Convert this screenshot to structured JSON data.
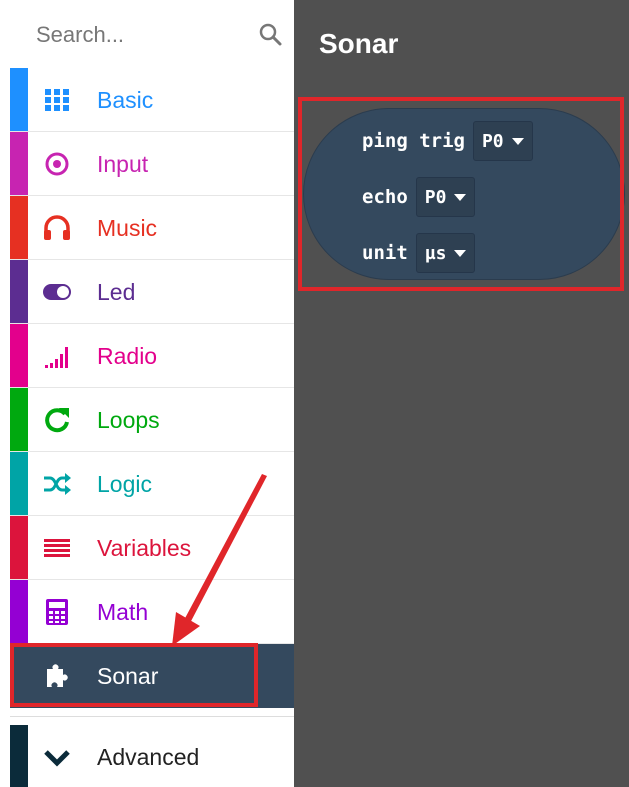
{
  "search": {
    "placeholder": "Search..."
  },
  "sidebar": {
    "items": [
      {
        "label": "Basic",
        "icon": "grid-icon",
        "color": "#1e90ff"
      },
      {
        "label": "Input",
        "icon": "target-icon",
        "color": "#c724b1"
      },
      {
        "label": "Music",
        "icon": "headphones-icon",
        "color": "#e63022"
      },
      {
        "label": "Led",
        "icon": "toggle-icon",
        "color": "#5c2d91"
      },
      {
        "label": "Radio",
        "icon": "signal-bars-icon",
        "color": "#e3008c"
      },
      {
        "label": "Loops",
        "icon": "refresh-icon",
        "color": "#00a90f"
      },
      {
        "label": "Logic",
        "icon": "shuffle-icon",
        "color": "#00a4a6"
      },
      {
        "label": "Variables",
        "icon": "lines-icon",
        "color": "#dc143c"
      },
      {
        "label": "Math",
        "icon": "calculator-icon",
        "color": "#9400d3"
      },
      {
        "label": "Sonar",
        "icon": "puzzle-icon",
        "color": "#34495e"
      }
    ],
    "advanced": {
      "label": "Advanced",
      "icon": "chevron-down-icon",
      "color": "#0b2b3a"
    }
  },
  "flyout": {
    "title": "Sonar",
    "block": {
      "row1_label": "ping trig",
      "row1_value": "P0",
      "row2_label": "echo",
      "row2_value": "P0",
      "row3_label": "unit",
      "row3_value": "µs"
    }
  },
  "annotation": {
    "highlight_color": "#e0262a"
  }
}
